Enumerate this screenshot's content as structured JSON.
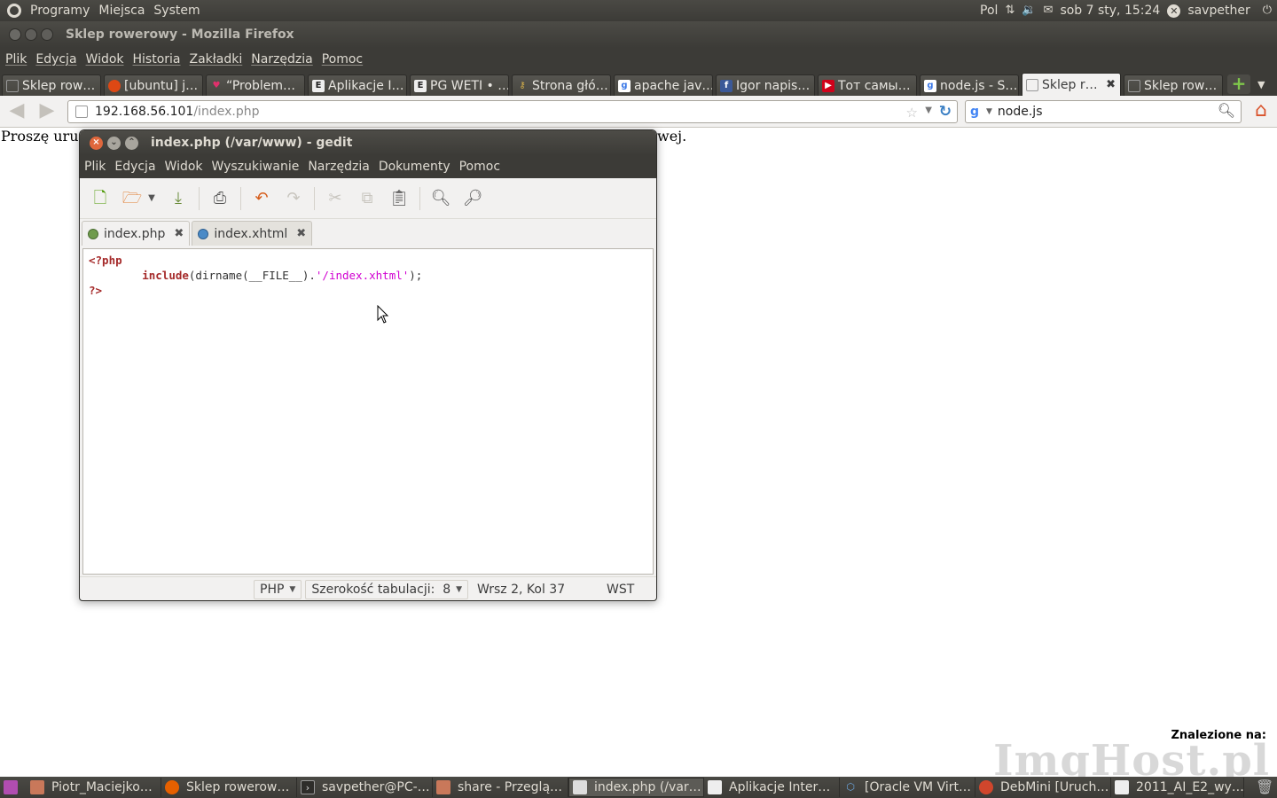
{
  "top_panel": {
    "menus": [
      "Programy",
      "Miejsca",
      "System"
    ],
    "keyboard": "Pol",
    "datetime": "sob 7 sty, 15:24",
    "user": "savpether"
  },
  "browser": {
    "window_title": "Sklep rowerowy - Mozilla Firefox",
    "menus": [
      "Plik",
      "Edycja",
      "Widok",
      "Historia",
      "Zakładki",
      "Narzędzia",
      "Pomoc"
    ],
    "tabs": [
      {
        "label": "Sklep row…",
        "icon": "page-icon"
      },
      {
        "label": "[ubuntu] j…",
        "icon": "ubuntu-icon"
      },
      {
        "label": "“Problem…",
        "icon": "heart-icon"
      },
      {
        "label": "Aplikacje I…",
        "icon": "eti-icon"
      },
      {
        "label": "PG WETI • …",
        "icon": "eti-icon"
      },
      {
        "label": "Strona głó…",
        "icon": "key-icon"
      },
      {
        "label": "apache jav…",
        "icon": "google-icon"
      },
      {
        "label": "Igor napis…",
        "icon": "facebook-icon"
      },
      {
        "label": "Тот самы…",
        "icon": "youtube-icon"
      },
      {
        "label": "node.js - S…",
        "icon": "google-icon"
      },
      {
        "label": "Sklep r…",
        "icon": "page-icon",
        "active": true
      },
      {
        "label": "Sklep row…",
        "icon": "page-icon"
      }
    ],
    "url_host": "192.168.56.101",
    "url_path": "/index.php",
    "search_value": "node.js"
  },
  "page": {
    "text_left": "Proszę uru",
    "text_right": "wej.",
    "found_label": "Znalezione na:",
    "watermark": "ImgHost.pl"
  },
  "gedit": {
    "title": "index.php (/var/www) - gedit",
    "menus": [
      "Plik",
      "Edycja",
      "Widok",
      "Wyszukiwanie",
      "Narzędzia",
      "Dokumenty",
      "Pomoc"
    ],
    "tabs": [
      {
        "label": "index.php",
        "active": true
      },
      {
        "label": "index.xhtml",
        "active": false
      }
    ],
    "code": {
      "line1": "<?php",
      "line2_kw": "include",
      "line2_a": "(dirname(__FILE__).",
      "line2_str": "'/index.xhtml'",
      "line2_b": ");",
      "line3": "?>"
    },
    "status": {
      "language": "PHP",
      "tab_width": "Szerokość tabulacji:  8",
      "position": "Wrsz 2, Kol 37",
      "mode": "WST"
    }
  },
  "taskbar": [
    {
      "label": "Piotr_Maciejko…",
      "icon": "image-viewer-icon"
    },
    {
      "label": "Sklep rowerow…",
      "icon": "firefox-icon"
    },
    {
      "label": "savpether@PC-…",
      "icon": "terminal-icon"
    },
    {
      "label": "share - Przeglą…",
      "icon": "folder-icon"
    },
    {
      "label": "index.php (/var…",
      "icon": "text-editor-icon",
      "active": true
    },
    {
      "label": "Aplikacje Inter…",
      "icon": "document-icon"
    },
    {
      "label": "[Oracle VM Virt…",
      "icon": "virtualbox-icon"
    },
    {
      "label": "DebMini [Uruch…",
      "icon": "vm-icon"
    },
    {
      "label": "2011_AI_E2_wy…",
      "icon": "document-icon"
    }
  ]
}
